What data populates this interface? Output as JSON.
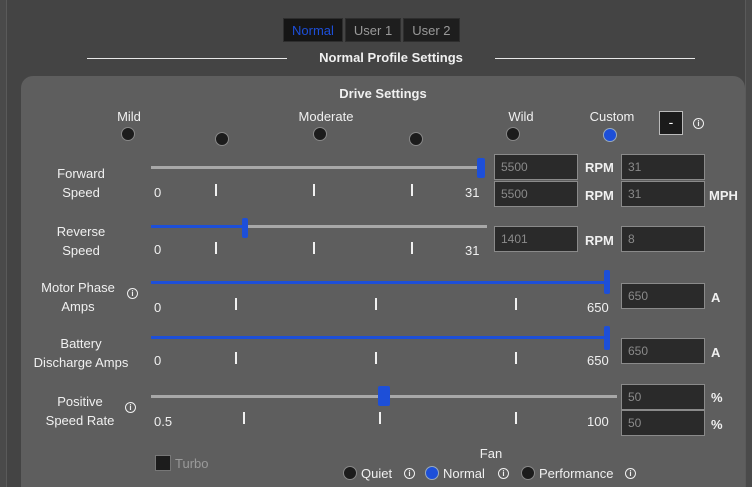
{
  "tabs": [
    "Normal",
    "User 1",
    "User 2"
  ],
  "section_title": "Normal Profile Settings",
  "drive_settings": {
    "title": "Drive Settings",
    "presets": [
      "Mild",
      "",
      "Moderate",
      "",
      "Wild",
      "Custom"
    ],
    "selected_preset": "Custom",
    "minus_label": "-"
  },
  "forward_speed": {
    "label_1": "Forward",
    "label_2": "Speed",
    "min": "0",
    "max": "31",
    "value_fraction": 1.0,
    "rpm_top": "5500",
    "rpm_bottom": "5500",
    "mph_top": "31",
    "mph_bottom": "31",
    "rpm_unit": "RPM",
    "mph_unit": "MPH"
  },
  "reverse_speed": {
    "label_1": "Reverse",
    "label_2": "Speed",
    "min": "0",
    "max": "31",
    "value_fraction": 0.28,
    "rpm": "1401",
    "mph": "8",
    "rpm_unit": "RPM"
  },
  "motor_phase_amps": {
    "label_1": "Motor Phase",
    "label_2": "Amps",
    "min": "0",
    "max": "650",
    "value_fraction": 1.0,
    "value": "650",
    "unit": "A"
  },
  "battery_discharge_amps": {
    "label_1": "Battery",
    "label_2": "Discharge Amps",
    "min": "0",
    "max": "650",
    "value_fraction": 1.0,
    "value": "650",
    "unit": "A"
  },
  "positive_speed_rate": {
    "label_1": "Positive",
    "label_2": "Speed Rate",
    "min": "0.5",
    "max": "100",
    "value_fraction": 0.5,
    "value_top": "50",
    "value_bottom": "50",
    "unit": "%"
  },
  "turbo_label": "Turbo",
  "fan": {
    "title": "Fan",
    "options": [
      "Quiet",
      "Normal",
      "Performance"
    ],
    "selected": "Normal"
  },
  "colors": {
    "accent": "#1d4fd8",
    "panel": "#5e5e5e",
    "background": "#444444"
  }
}
